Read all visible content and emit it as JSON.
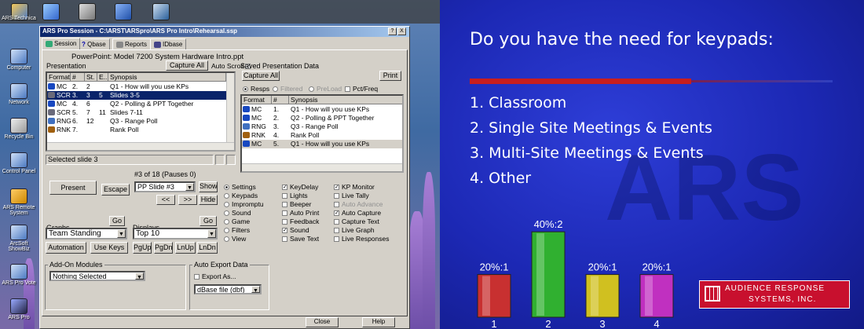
{
  "desktop": {
    "icons": [
      {
        "label": "ARS Technica"
      },
      {
        "label": "Computer"
      },
      {
        "label": "Network"
      },
      {
        "label": "Recycle Bin"
      },
      {
        "label": "Control Panel"
      },
      {
        "label": "ARS Remote System"
      },
      {
        "label": "ArcSoft ShowBiz"
      },
      {
        "label": "ARS Pro Vote"
      },
      {
        "label": "ARS Pro"
      }
    ]
  },
  "window": {
    "title": "ARS Pro Session - C:\\ARST\\ARSpro\\ARS Pro Intro\\Rehearsal.ssp",
    "title_buttons": [
      "?",
      "X"
    ],
    "tabs": [
      "Session",
      "Qbase",
      "Reports",
      "IDbase"
    ],
    "file_title": "PowerPoint: Model 7200 System Hardware Intro.ppt",
    "presentation": {
      "label": "Presentation",
      "capture_all": "Capture All",
      "auto_scroll": "Auto Scroll",
      "headers": [
        "Format",
        "#",
        "St.",
        "E..",
        "Synopsis"
      ],
      "rows": [
        [
          "MC",
          "2.",
          "2",
          "",
          "Q1 - How will you use KPs"
        ],
        [
          "SCR",
          "3.",
          "3",
          "5",
          "Slides 3-5"
        ],
        [
          "MC",
          "4.",
          "6",
          "",
          "Q2 - Polling & PPT Together"
        ],
        [
          "SCR",
          "5.",
          "7",
          "11",
          "Slides 7-11"
        ],
        [
          "RNG",
          "6.",
          "12",
          "",
          "Q3 - Range Poll"
        ],
        [
          "RNK",
          "7.",
          "",
          "",
          "Rank Poll"
        ]
      ],
      "status": "Selected slide 3"
    },
    "saved": {
      "label": "Saved Presentation Data",
      "capture_all": "Capture All",
      "print": "Print",
      "filters": [
        "Resps",
        "Filtered",
        "PreLoad",
        "Pct/Freq"
      ],
      "headers": [
        "Format",
        "#",
        "Synopsis"
      ],
      "rows": [
        [
          "MC",
          "1.",
          "Q1 - How will you use KPs"
        ],
        [
          "MC",
          "2.",
          "Q2 - Polling & PPT Together"
        ],
        [
          "RNG",
          "3.",
          "Q3 - Range Poll"
        ],
        [
          "RNK",
          "4.",
          "Rank Poll"
        ],
        [
          "MC",
          "5.",
          "Q1 - How will you use KPs"
        ]
      ]
    },
    "controls": {
      "counter": "#3 of 18 (Pauses 0)",
      "present": "Present",
      "escape": "Escape",
      "slide_select": "PP Slide #3",
      "show": "Show",
      "prev": "<<",
      "next": ">>",
      "hide": "Hide"
    },
    "options": [
      "Settings",
      "Keypads",
      "Impromptu",
      "Sound",
      "Game",
      "Filters",
      "View"
    ],
    "checks": [
      [
        "KeyDelay",
        true,
        false
      ],
      [
        "Lights",
        false,
        false
      ],
      [
        "Beeper",
        false,
        false
      ],
      [
        "Auto Print",
        false,
        false
      ],
      [
        "Feedback",
        false,
        false
      ],
      [
        "Sound",
        true,
        false
      ],
      [
        "Save Text",
        false,
        false
      ]
    ],
    "checks2": [
      [
        "KP Monitor",
        true,
        false
      ],
      [
        "Live Tally",
        false,
        false
      ],
      [
        "Auto Advance",
        false,
        true
      ],
      [
        "Auto Capture",
        true,
        false
      ],
      [
        "Capture Text",
        false,
        false
      ],
      [
        "Live Graph",
        false,
        false
      ],
      [
        "Live Responses",
        false,
        false
      ]
    ],
    "graphs": {
      "label": "Graphs",
      "go": "Go",
      "value": "Team Standing",
      "automation": "Automation",
      "use_keys": "Use Keys"
    },
    "displays": {
      "label": "Displays",
      "go": "Go",
      "value": "Top 10",
      "nav": [
        "PgUp",
        "PgDn",
        "LnUp",
        "LnDn"
      ]
    },
    "addon": {
      "label": "Add-On Modules",
      "value": "Nothing Selected"
    },
    "export": {
      "label": "Auto Export Data",
      "export_as": "Export As...",
      "format": "dBase file (dbf)"
    },
    "close": "Close",
    "help": "Help"
  },
  "slide": {
    "question": "Do you have the need for keypads:",
    "options": [
      "1. Classroom",
      "2. Single Site Meetings & Events",
      "3. Multi-Site Meetings & Events",
      "4. Other"
    ],
    "logo_text": [
      "AUDIENCE RESPONSE",
      "SYSTEMS, INC."
    ],
    "colors": {
      "accent_line": "#c81e1e",
      "bar1": "#c83030",
      "bar2": "#30b030",
      "bar3": "#d0c020",
      "bar4": "#c030c0"
    }
  },
  "chart_data": {
    "type": "bar",
    "categories": [
      "1",
      "2",
      "3",
      "4"
    ],
    "values": [
      20,
      40,
      20,
      20
    ],
    "counts": [
      1,
      2,
      1,
      1
    ],
    "labels": [
      "20%:1",
      "40%:2",
      "20%:1",
      "20%:1"
    ]
  }
}
